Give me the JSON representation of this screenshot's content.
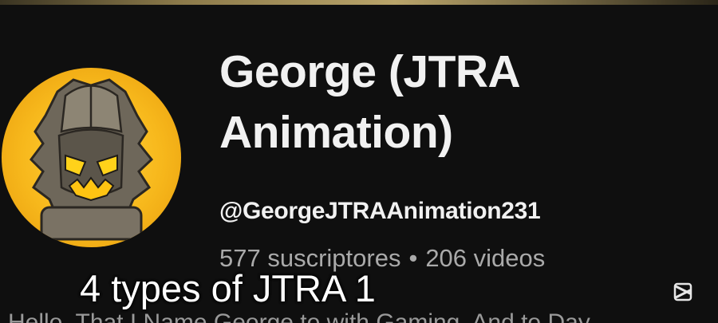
{
  "channel": {
    "name": "George (JTRA Animation)",
    "handle": "@GeorgeJTRAAnimation231",
    "subscribers": "577 suscriptores",
    "separator": "•",
    "videos": "206 videos"
  },
  "overlay": {
    "caption": "4 types of JTRA 1",
    "subtitle": "Hello, That I Name George to with Gaming. And to Day"
  },
  "icons": {
    "avatar": "robot-mascot-avatar",
    "watermark": "capcut-icon"
  },
  "colors": {
    "background": "#0f0f0f",
    "primary_text": "#f1f1f1",
    "secondary_text": "#aaaaaa",
    "avatar_bg": "#f7b81c"
  }
}
